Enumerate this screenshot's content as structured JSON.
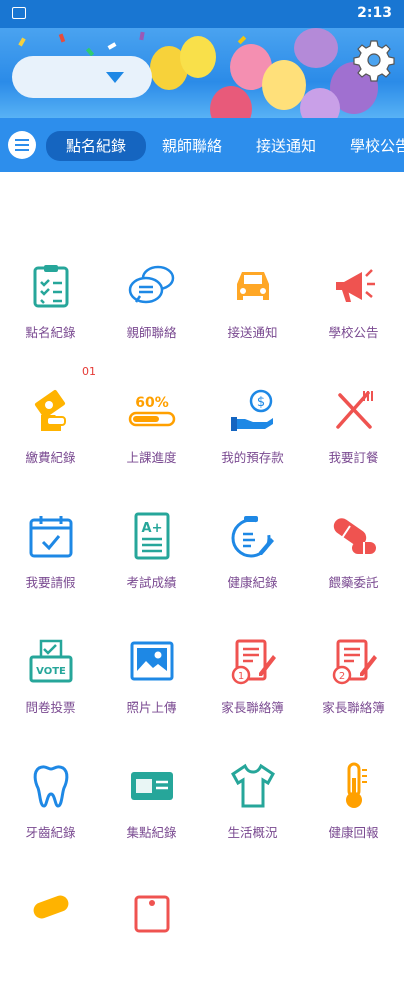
{
  "status_bar": {
    "time": "2:13"
  },
  "header": {
    "dropdown_value": ""
  },
  "tabs": [
    {
      "label": "點名紀錄",
      "active": true
    },
    {
      "label": "親師聯絡",
      "active": false
    },
    {
      "label": "接送通知",
      "active": false
    },
    {
      "label": "學校公告",
      "active": false
    }
  ],
  "badge_count": "01",
  "grid": [
    {
      "label": "點名紀錄",
      "icon": "clipboard-checklist-icon"
    },
    {
      "label": "親師聯絡",
      "icon": "chat-bubbles-icon"
    },
    {
      "label": "接送通知",
      "icon": "car-icon"
    },
    {
      "label": "學校公告",
      "icon": "megaphone-icon"
    },
    {
      "label": "繳費紀錄",
      "icon": "money-hand-icon"
    },
    {
      "label": "上課進度",
      "icon": "progress-bar-icon",
      "progress_text": "60%"
    },
    {
      "label": "我的預存款",
      "icon": "deposit-hand-icon"
    },
    {
      "label": "我要訂餐",
      "icon": "fork-knife-icon"
    },
    {
      "label": "我要請假",
      "icon": "calendar-check-icon"
    },
    {
      "label": "考試成績",
      "icon": "grade-paper-icon",
      "grade_text": "A+"
    },
    {
      "label": "健康紀錄",
      "icon": "health-clipboard-icon"
    },
    {
      "label": "餵藥委託",
      "icon": "pill-capsule-icon"
    },
    {
      "label": "問卷投票",
      "icon": "ballot-box-icon",
      "vote_text": "VOTE"
    },
    {
      "label": "照片上傳",
      "icon": "image-icon"
    },
    {
      "label": "家長聯絡簿",
      "icon": "notebook-1-icon",
      "num": "1"
    },
    {
      "label": "家長聯絡簿",
      "icon": "notebook-2-icon",
      "num": "2"
    },
    {
      "label": "牙齒紀錄",
      "icon": "tooth-icon"
    },
    {
      "label": "集點紀錄",
      "icon": "points-card-icon"
    },
    {
      "label": "生活概況",
      "icon": "tshirt-icon"
    },
    {
      "label": "健康回報",
      "icon": "thermometer-icon"
    }
  ],
  "colors": {
    "primary": "#2d8eec",
    "label": "#7a4a91"
  }
}
